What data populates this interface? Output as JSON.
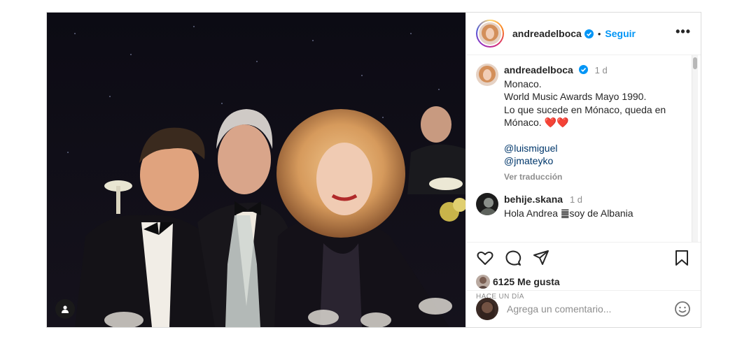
{
  "post": {
    "username": "andreadelboca",
    "follow_label": "Seguir",
    "dot": "•",
    "more": "•••"
  },
  "caption": {
    "username": "andreadelboca",
    "time": "1 d",
    "lines": [
      "Monaco.",
      "World Music Awards Mayo 1990.",
      "Lo que sucede en Mónaco, queda en",
      "Mónaco. ❤️❤️"
    ],
    "mentions": [
      "@luismiguel",
      "@jmateyko"
    ],
    "translate_label": "Ver traducción"
  },
  "comments": [
    {
      "username": "behije.skana",
      "time": "1 d",
      "text": "Hola Andrea ䷀soy de Albania"
    }
  ],
  "likes": {
    "count_text": "6125 Me gusta"
  },
  "timestamp": "HACE UN DÍA",
  "add_comment": {
    "placeholder": "Agrega un comentario..."
  },
  "icons": {
    "verified": "verified-badge-icon",
    "like": "heart-icon",
    "comment": "comment-icon",
    "share": "share-icon",
    "save": "bookmark-icon",
    "emoji": "emoji-icon",
    "tag": "user-tag-icon"
  },
  "colors": {
    "link": "#0095f6",
    "verified": "#0095f6",
    "mention": "#00376b"
  }
}
